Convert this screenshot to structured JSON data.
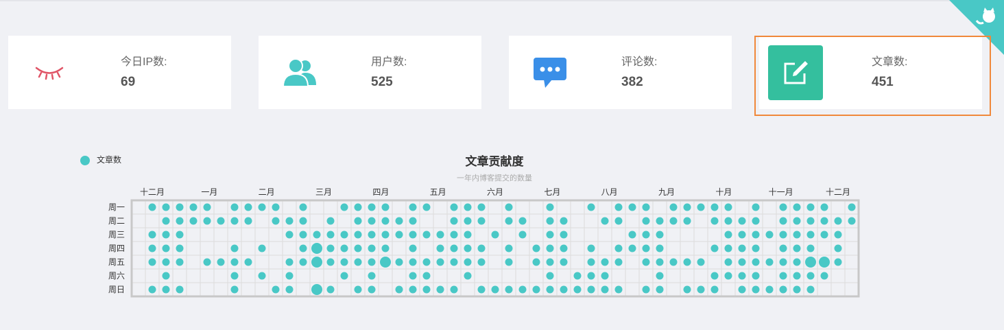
{
  "colors": {
    "teal": "#49c8c6",
    "pink": "#e05567",
    "blue": "#3a8fe8",
    "green": "#34bf9e",
    "orange": "#f0883a"
  },
  "cards": [
    {
      "icon": "eye-closed-icon",
      "label": "今日IP数:",
      "value": "69"
    },
    {
      "icon": "users-icon",
      "label": "用户数:",
      "value": "525"
    },
    {
      "icon": "chat-bubble-icon",
      "label": "评论数:",
      "value": "382"
    },
    {
      "icon": "edit-icon",
      "label": "文章数:",
      "value": "451"
    }
  ],
  "chart_data": {
    "type": "heatmap",
    "title": "文章贡献度",
    "subtitle": "一年内博客提交的数量",
    "legend": [
      "文章数"
    ],
    "legend_position": "top-left",
    "month_labels": [
      "十二月",
      "一月",
      "二月",
      "三月",
      "四月",
      "五月",
      "六月",
      "七月",
      "八月",
      "九月",
      "十月",
      "十一月",
      "十二月"
    ],
    "day_labels": [
      "周一",
      "周二",
      "周三",
      "周四",
      "周五",
      "周六",
      "周日"
    ],
    "weeks": 53,
    "rows": [
      "0111110111101001111011011101001001011101111101011110111100011111101",
      "0011111110111010111110011101101100110111101111011111101111110111111",
      "0111000000011111111111111010101100001110000111111111001000001111100",
      "0111000101001211111010111101011101011110001111011101001000011111100",
      "0111011110011211112111111101011101110111110111111221001111111111100",
      "0010000101010001010011001000001011100010001111011110011111111110000",
      "0111000100110210110111110111111111110110111011111100000010011111001"
    ]
  }
}
